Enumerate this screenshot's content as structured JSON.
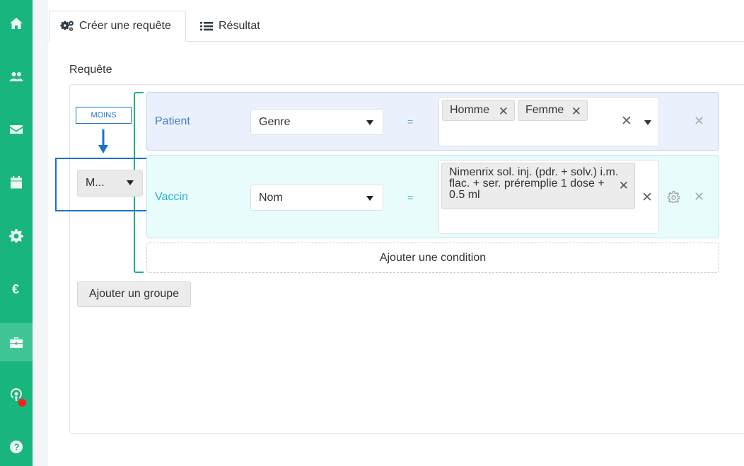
{
  "sidebar": {
    "items": [
      {
        "icon": "home-icon"
      },
      {
        "icon": "users-icon"
      },
      {
        "icon": "envelope-icon"
      },
      {
        "icon": "calendar-icon"
      },
      {
        "icon": "gear-icon"
      },
      {
        "icon": "euro-icon"
      },
      {
        "icon": "toolbox-icon",
        "active": true
      },
      {
        "icon": "podcast-icon",
        "notification": true
      },
      {
        "icon": "help-icon"
      }
    ],
    "color": "#18b67d",
    "notification_color": "#ff1a1a"
  },
  "tabs": [
    {
      "label": "Créer une requête",
      "icon": "cogs-icon",
      "active": true
    },
    {
      "label": "Résultat",
      "icon": "list-icon",
      "active": false
    }
  ],
  "query": {
    "label": "Requête",
    "annotation": "MOINS",
    "group_operator": "M...",
    "rules": [
      {
        "entity": "Patient",
        "field": "Genre",
        "operator": "=",
        "values": [
          "Homme",
          "Femme"
        ],
        "color": "#4a7bd6"
      },
      {
        "entity": "Vaccin",
        "field": "Nom",
        "operator": "=",
        "values": [
          "Nimenrix sol. inj. (pdr. + solv.) i.m. flac. + ser. préremplie 1 dose + 0.5 ml"
        ],
        "color": "#27b3cc"
      }
    ],
    "add_condition_label": "Ajouter une condition",
    "add_group_label": "Ajouter un groupe"
  },
  "glyphs": {
    "remove": "✕"
  }
}
